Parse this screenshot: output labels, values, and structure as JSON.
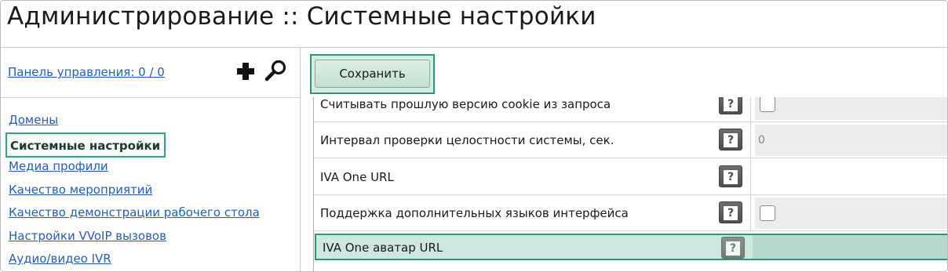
{
  "page": {
    "title": "Администрирование :: Системные настройки"
  },
  "sidebar": {
    "panel_link": "Панель управления: 0 / 0",
    "add_icon": "plus-icon",
    "search_icon": "magnifier-icon",
    "items": [
      {
        "label": "Домены",
        "active": false
      },
      {
        "label": "Системные настройки",
        "active": true
      },
      {
        "label": "Медиа профили",
        "active": false
      },
      {
        "label": "Качество мероприятий",
        "active": false
      },
      {
        "label": "Качество демонстрации рабочего стола",
        "active": false
      },
      {
        "label": "Настройки VVoIP вызовов",
        "active": false
      },
      {
        "label": "Аудио/видео IVR",
        "active": false
      }
    ]
  },
  "toolbar": {
    "save_label": "Сохранить"
  },
  "settings": {
    "rows": [
      {
        "label": "Считывать прошлую версию cookie из запроса",
        "type": "checkbox"
      },
      {
        "label": "Интервал проверки целостности системы, сек.",
        "type": "number",
        "value": "0"
      },
      {
        "label": "IVA One URL",
        "type": "text",
        "value": ""
      },
      {
        "label": "Поддержка дополнительных языков интерфейса",
        "type": "checkbox"
      },
      {
        "label": "IVA One аватар URL",
        "type": "text",
        "value": ""
      }
    ],
    "help_glyph": "?"
  },
  "colors": {
    "link": "#1f5fbf",
    "accent_green": "#2a9a73",
    "highlight": "#cfe8de"
  }
}
